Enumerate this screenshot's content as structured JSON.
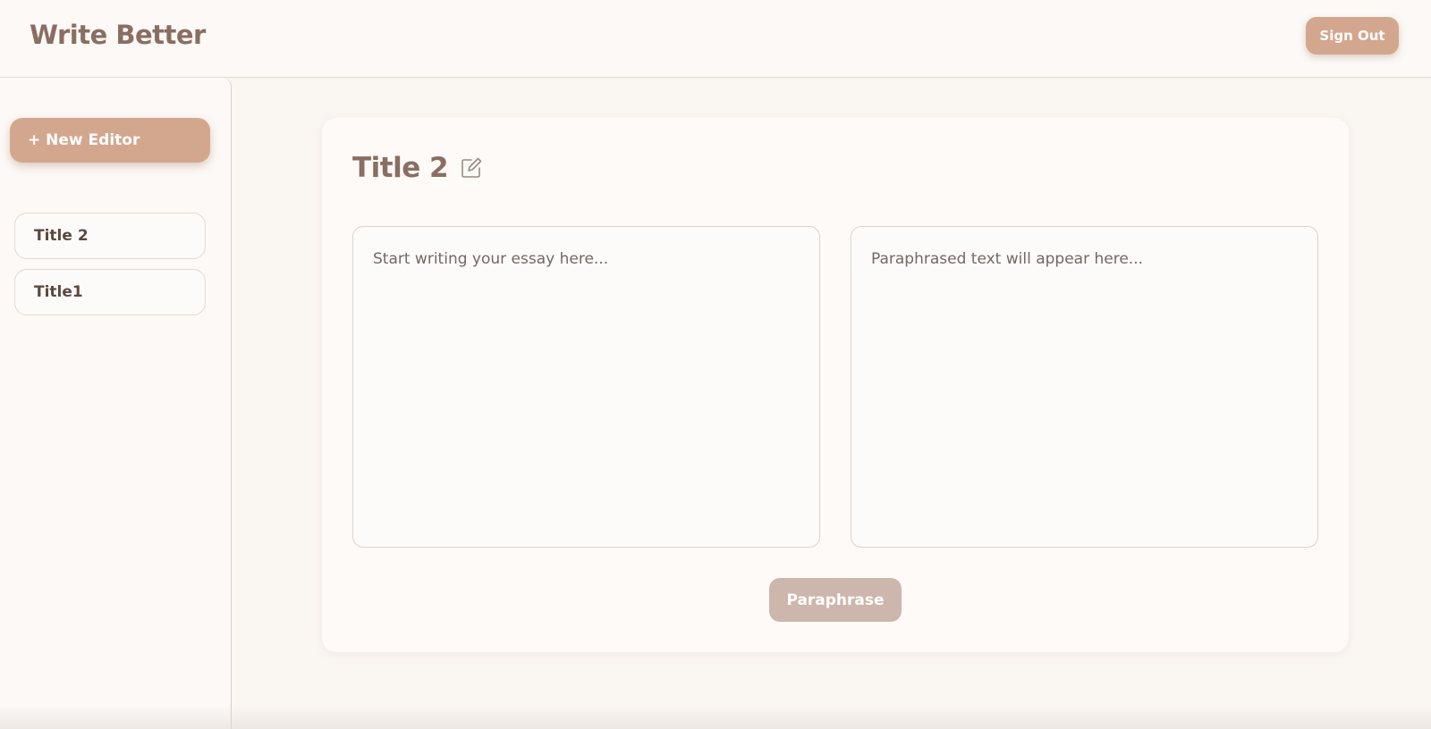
{
  "header": {
    "brand": "Write Better",
    "sign_out_label": "Sign Out"
  },
  "sidebar": {
    "new_editor_label": "+ New Editor",
    "documents": [
      {
        "label": "Title 2"
      },
      {
        "label": "Title1"
      }
    ]
  },
  "editor": {
    "title": "Title 2",
    "edit_icon": "edit-icon",
    "input_placeholder": "Start writing your essay here...",
    "output_placeholder": "Paraphrased text will appear here...",
    "paraphrase_label": "Paraphrase"
  },
  "colors": {
    "accent": "#d3a78e",
    "accent_disabled": "#cdb6ab",
    "text": "#8a6e62",
    "background": "#faf6f2"
  }
}
